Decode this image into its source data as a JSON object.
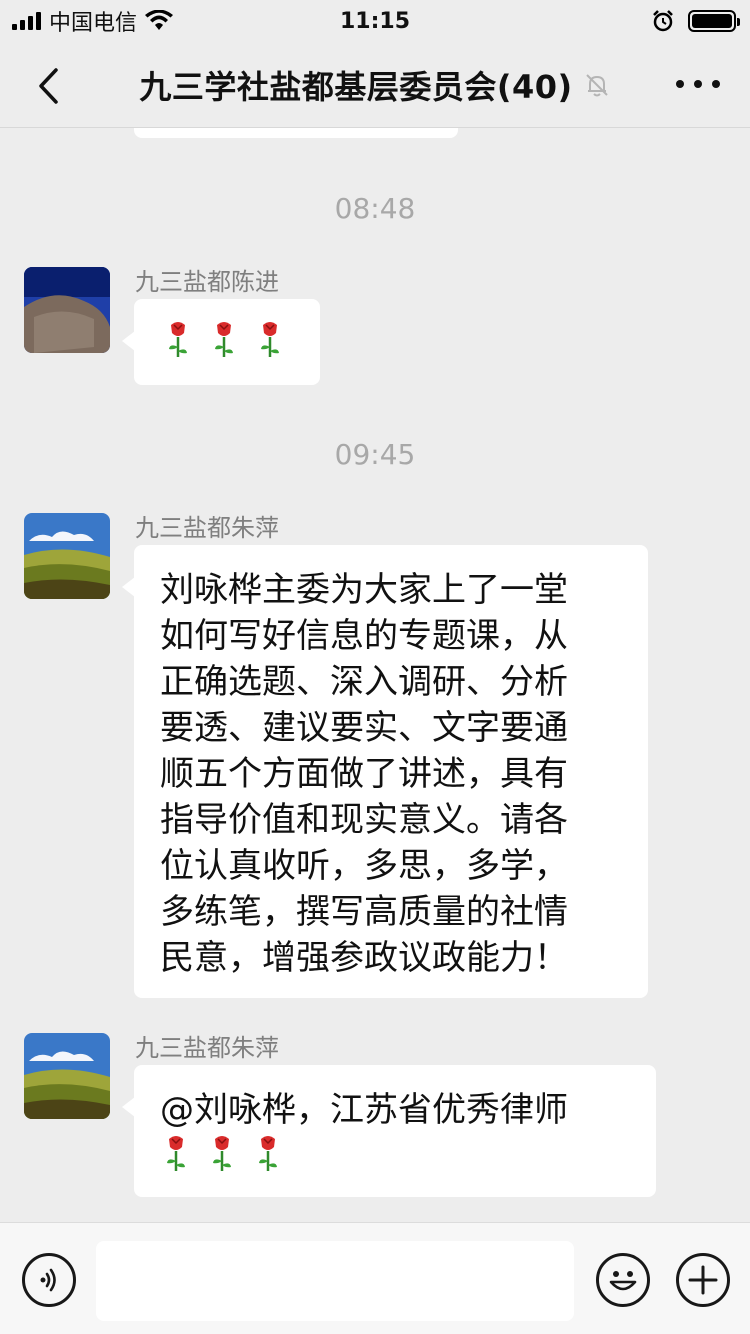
{
  "status_bar": {
    "carrier": "中国电信",
    "time": "11:15"
  },
  "nav": {
    "title": "九三学社盐都基层委员会(40)"
  },
  "messages": [
    {
      "type": "timestamp",
      "text": "08:48"
    },
    {
      "type": "message",
      "sender": "九三盐都陈进",
      "content": "",
      "emoji": [
        "rose-emoji",
        "rose-emoji",
        "rose-emoji"
      ]
    },
    {
      "type": "timestamp",
      "text": "09:45"
    },
    {
      "type": "message",
      "sender": "九三盐都朱萍",
      "lines": [
        "刘咏桦主委为大家上了一堂",
        "如何写好信息的专题课，从",
        "正确选题、深入调研、分析",
        "要透、建议要实、文字要通",
        "顺五个方面做了讲述，具有",
        "指导价值和现实意义。请各",
        "位认真收听，多思，多学，",
        "多练笔，撰写高质量的社情",
        "民意，增强参政议政能力！"
      ]
    },
    {
      "type": "message",
      "sender": "九三盐都朱萍",
      "content": "@刘咏桦，江苏省优秀律师",
      "emoji": [
        "rose-emoji",
        "rose-emoji",
        "rose-emoji"
      ]
    }
  ],
  "icons": {
    "back": "chevron-left-icon",
    "mute": "bell-muted-icon",
    "more": "more-icon",
    "voice": "voice-icon",
    "emoji": "emoji-icon",
    "plus": "plus-icon"
  },
  "colors": {
    "background": "#ededed",
    "bubble": "#ffffff",
    "timestamp": "#a8a8a8",
    "sender": "#7f7f7f"
  }
}
